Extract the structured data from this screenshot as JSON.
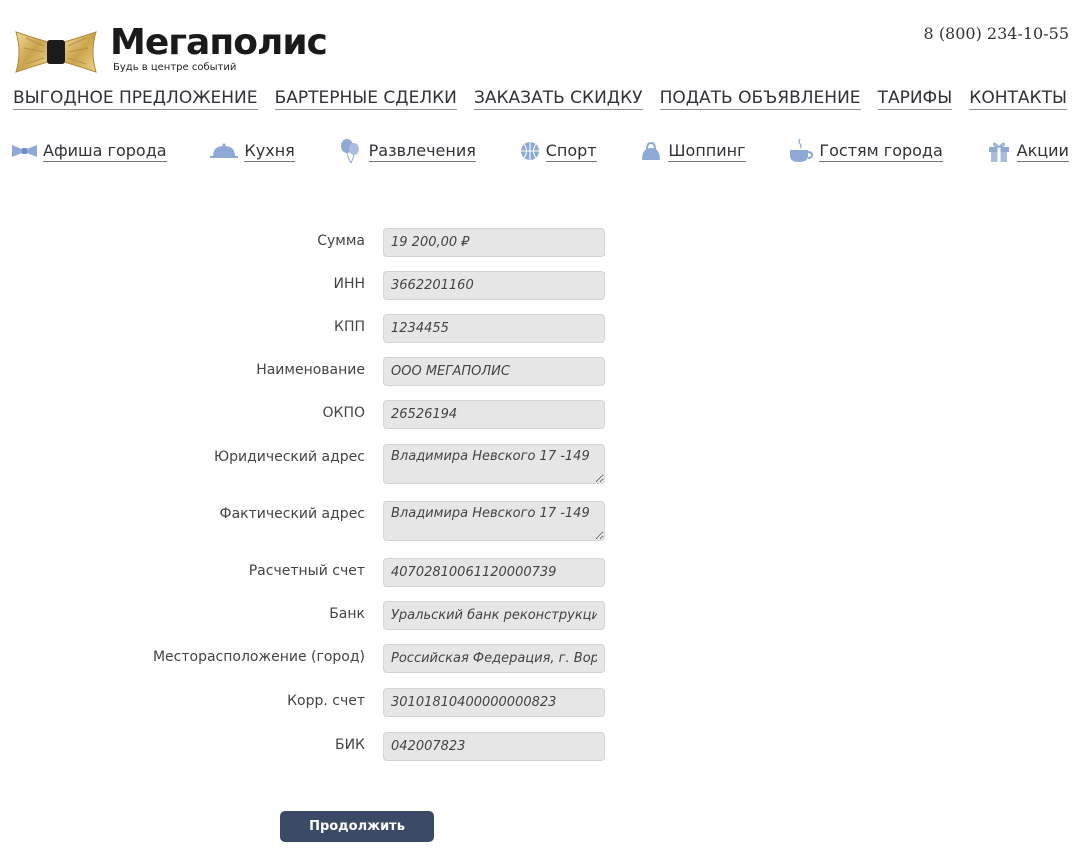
{
  "header": {
    "logo_title": "Мегаполис",
    "logo_tagline": "Будь в центре событий",
    "phone": "8 (800) 234-10-55"
  },
  "main_nav": [
    {
      "label": "ВЫГОДНОЕ ПРЕДЛОЖЕНИЕ"
    },
    {
      "label": "БАРТЕРНЫЕ СДЕЛКИ"
    },
    {
      "label": "ЗАКАЗАТЬ СКИДКУ"
    },
    {
      "label": "ПОДАТЬ ОБЪЯВЛЕНИЕ"
    },
    {
      "label": "ТАРИФЫ"
    },
    {
      "label": "КОНТАКТЫ"
    }
  ],
  "category_nav": [
    {
      "label": "Афиша города",
      "icon": "bowtie-icon"
    },
    {
      "label": "Кухня",
      "icon": "cloche-icon"
    },
    {
      "label": "Развлечения",
      "icon": "balloons-icon"
    },
    {
      "label": "Спорт",
      "icon": "ball-icon"
    },
    {
      "label": "Шоппинг",
      "icon": "bag-icon"
    },
    {
      "label": "Гостям города",
      "icon": "cup-icon"
    },
    {
      "label": "Акции",
      "icon": "gift-icon"
    }
  ],
  "form": {
    "fields": [
      {
        "label": "Сумма",
        "value": "19 200,00 ₽"
      },
      {
        "label": "ИНН",
        "value": "3662201160"
      },
      {
        "label": "КПП",
        "value": "1234455"
      },
      {
        "label": "Наименование",
        "value": "ООО МЕГАПОЛИС"
      },
      {
        "label": "ОКПО",
        "value": "26526194"
      },
      {
        "label": "Юридический адрес",
        "value": "Владимира Невского 17 -149"
      },
      {
        "label": "Фактический адрес",
        "value": "Владимира Невского 17 -149"
      },
      {
        "label": "Расчетный счет",
        "value": "40702810061120000739"
      },
      {
        "label": "Банк",
        "value": "Уральский банк реконструкции и развития"
      },
      {
        "label": "Месторасположение (город)",
        "value": "Российская Федерация, г. Воронеж"
      },
      {
        "label": "Корр. счет",
        "value": "30101810400000000823"
      },
      {
        "label": "БИК",
        "value": "042007823"
      }
    ],
    "submit_label": "Продолжить"
  },
  "colors": {
    "icon": "#8fa9d6",
    "button": "#3a4a66",
    "field_bg": "#e6e6e6"
  }
}
